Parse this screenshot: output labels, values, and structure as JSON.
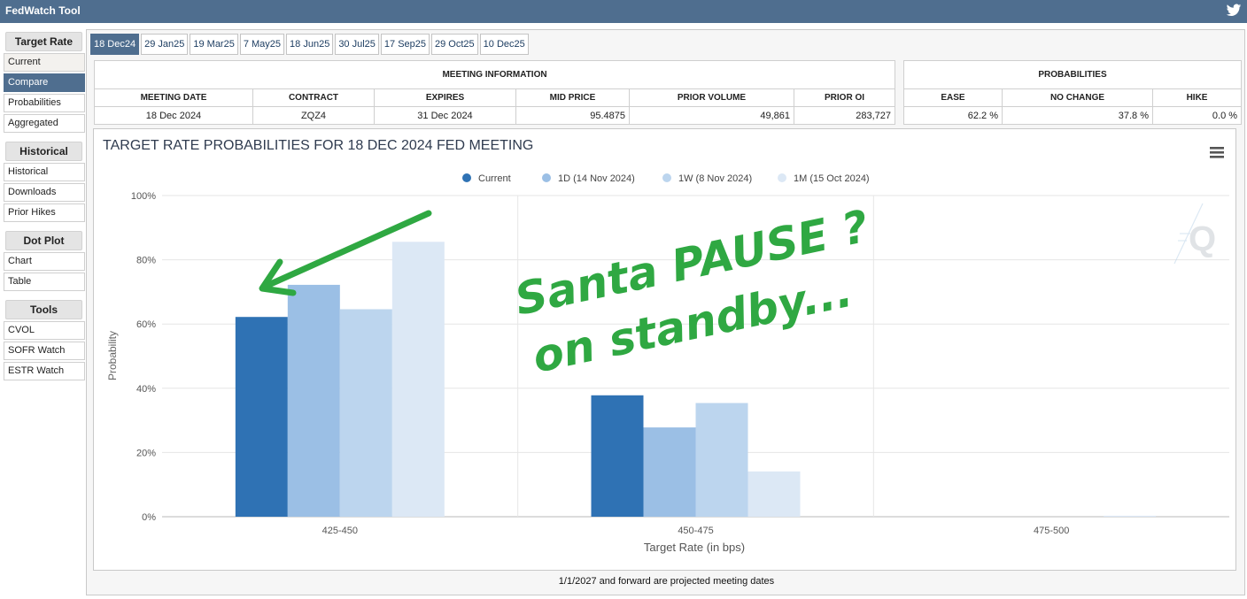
{
  "app": {
    "title": "FedWatch Tool"
  },
  "sidebar": {
    "sections": [
      {
        "heading": "Target Rate",
        "items": [
          "Current",
          "Compare",
          "Probabilities",
          "Aggregated"
        ]
      },
      {
        "heading": "Historical",
        "items": [
          "Historical",
          "Downloads",
          "Prior Hikes"
        ]
      },
      {
        "heading": "Dot Plot",
        "items": [
          "Chart",
          "Table"
        ]
      },
      {
        "heading": "Tools",
        "items": [
          "CVOL",
          "SOFR Watch",
          "ESTR Watch"
        ]
      }
    ],
    "active_item": "Compare"
  },
  "tabs": [
    "18 Dec24",
    "29 Jan25",
    "19 Mar25",
    "7 May25",
    "18 Jun25",
    "30 Jul25",
    "17 Sep25",
    "29 Oct25",
    "10 Dec25"
  ],
  "active_tab": "18 Dec24",
  "meeting_info": {
    "heading": "MEETING INFORMATION",
    "columns": [
      "MEETING DATE",
      "CONTRACT",
      "EXPIRES",
      "MID PRICE",
      "PRIOR VOLUME",
      "PRIOR OI"
    ],
    "values": [
      "18 Dec 2024",
      "ZQZ4",
      "31 Dec 2024",
      "95.4875",
      "49,861",
      "283,727"
    ]
  },
  "probabilities": {
    "heading": "PROBABILITIES",
    "columns": [
      "EASE",
      "NO CHANGE",
      "HIKE"
    ],
    "values": [
      "62.2 %",
      "37.8 %",
      "0.0 %"
    ]
  },
  "annotation": {
    "line1": "Santa PAUSE ?",
    "line2": "on standby..."
  },
  "footer": "1/1/2027 and forward are projected meeting dates",
  "chart_data": {
    "type": "bar",
    "title": "TARGET RATE PROBABILITIES FOR 18 DEC 2024 FED MEETING",
    "xlabel": "Target Rate (in bps)",
    "ylabel": "Probability",
    "categories": [
      "425-450",
      "450-475",
      "475-500"
    ],
    "ylim": [
      0,
      100
    ],
    "yticks": [
      "0%",
      "20%",
      "40%",
      "60%",
      "80%",
      "100%"
    ],
    "legend_position": "top-center",
    "series": [
      {
        "name": "Current",
        "color": "#2f72b4",
        "values": [
          62.2,
          37.8,
          0.0
        ]
      },
      {
        "name": "1D (14 Nov 2024)",
        "color": "#9bbfe5",
        "values": [
          72.2,
          27.8,
          0.0
        ]
      },
      {
        "name": "1W (8 Nov 2024)",
        "color": "#bcd5ee",
        "values": [
          64.6,
          35.4,
          0.0
        ]
      },
      {
        "name": "1M (15 Oct 2024)",
        "color": "#dce8f5",
        "values": [
          85.6,
          14.1,
          0.3
        ]
      }
    ]
  }
}
